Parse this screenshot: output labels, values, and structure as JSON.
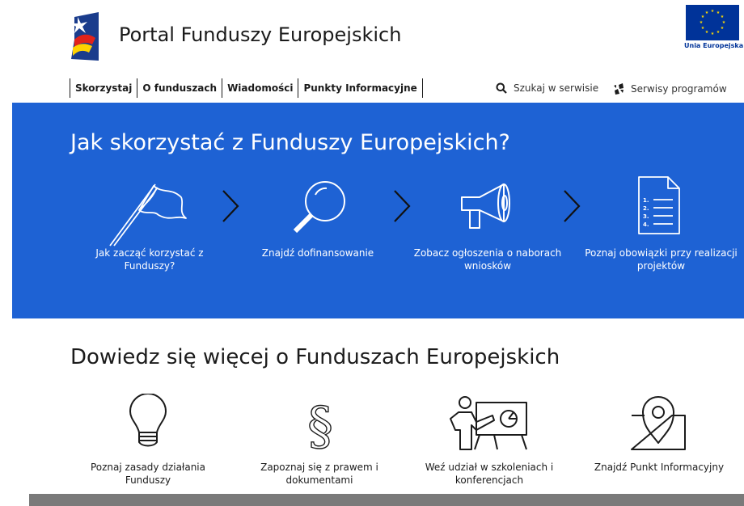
{
  "header": {
    "title": "Portal Funduszy Europejskich",
    "eu_caption": "Unia Europejska",
    "logo_icon": "fe-logo-icon"
  },
  "nav": {
    "items": [
      {
        "label": "Skorzystaj"
      },
      {
        "label": "O funduszach"
      },
      {
        "label": "Wiadomości"
      },
      {
        "label": "Punkty Informacyjne"
      }
    ],
    "search_label": "Szukaj w serwisie",
    "programs_label": "Serwisy programów"
  },
  "hero": {
    "title": "Jak skorzystać z Funduszy Europejskich?",
    "steps": [
      {
        "label": "Jak zacząć korzystać z Funduszy?",
        "icon": "flag-icon"
      },
      {
        "label": "Znajdź dofinansowanie",
        "icon": "magnifier-icon"
      },
      {
        "label": "Zobacz ogłoszenia o naborach wniosków",
        "icon": "megaphone-icon"
      },
      {
        "label": "Poznaj obowiązki przy realizacji projektów",
        "icon": "document-list-icon"
      }
    ],
    "colors": {
      "background": "#1e62d4",
      "text": "#ffffff"
    }
  },
  "learn": {
    "title": "Dowiedz się więcej o Funduszach Europejskich",
    "items": [
      {
        "label": "Poznaj zasady działania Funduszy",
        "icon": "lightbulb-icon"
      },
      {
        "label": "Zapoznaj się z prawem i dokumentami",
        "icon": "paragraph-icon"
      },
      {
        "label": "Weź udział w szkoleniach i konferencjach",
        "icon": "presentation-icon"
      },
      {
        "label": "Znajdź Punkt Informacyjny",
        "icon": "map-pin-icon"
      }
    ]
  }
}
